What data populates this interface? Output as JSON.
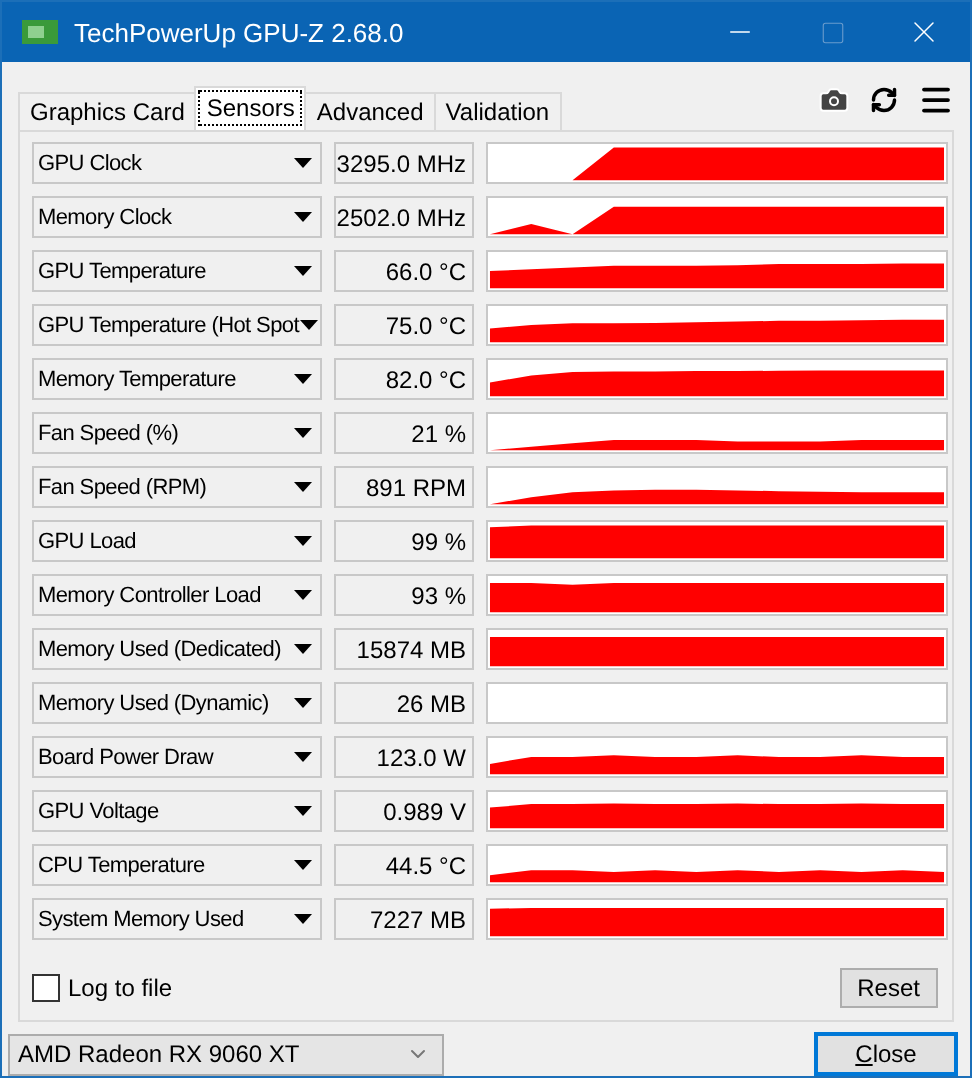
{
  "window": {
    "title": "TechPowerUp GPU-Z 2.68.0"
  },
  "tabs": [
    {
      "label": "Graphics Card",
      "selected": false
    },
    {
      "label": "Sensors",
      "selected": true
    },
    {
      "label": "Advanced",
      "selected": false
    },
    {
      "label": "Validation",
      "selected": false
    }
  ],
  "sensors": [
    {
      "name": "GPU Clock",
      "value": "3295.0 MHz"
    },
    {
      "name": "Memory Clock",
      "value": "2502.0 MHz"
    },
    {
      "name": "GPU Temperature",
      "value": "66.0 °C"
    },
    {
      "name": "GPU Temperature (Hot Spot",
      "value": "75.0 °C"
    },
    {
      "name": "Memory Temperature",
      "value": "82.0 °C"
    },
    {
      "name": "Fan Speed (%)",
      "value": "21 %"
    },
    {
      "name": "Fan Speed (RPM)",
      "value": "891 RPM"
    },
    {
      "name": "GPU Load",
      "value": "99 %"
    },
    {
      "name": "Memory Controller Load",
      "value": "93 %"
    },
    {
      "name": "Memory Used (Dedicated)",
      "value": "15874 MB"
    },
    {
      "name": "Memory Used (Dynamic)",
      "value": "26 MB"
    },
    {
      "name": "Board Power Draw",
      "value": "123.0 W"
    },
    {
      "name": "GPU Voltage",
      "value": "0.989 V"
    },
    {
      "name": "CPU Temperature",
      "value": "44.5 °C"
    },
    {
      "name": "System Memory Used",
      "value": "7227 MB"
    }
  ],
  "log_to_file": {
    "label": "Log to file",
    "checked": false
  },
  "reset_button": "Reset",
  "device": "AMD Radeon RX 9060 XT",
  "close_button": "Close"
}
